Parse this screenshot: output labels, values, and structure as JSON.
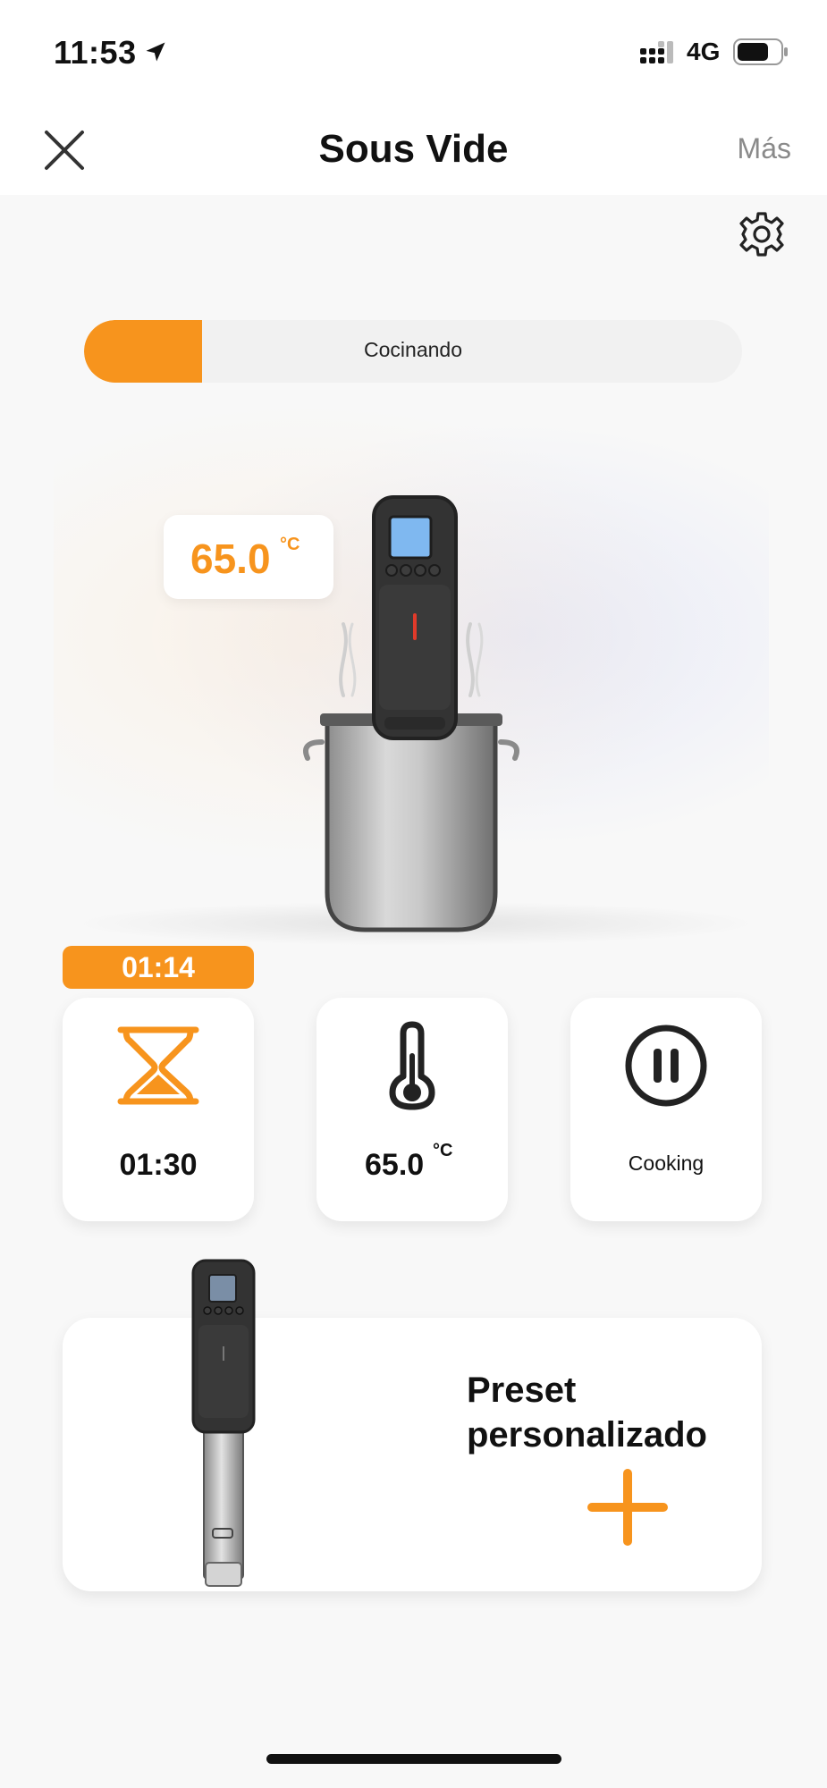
{
  "status_bar": {
    "time": "11:53",
    "network": "4G"
  },
  "header": {
    "title": "Sous Vide",
    "more_label": "Más"
  },
  "cooking": {
    "status_label": "Cocinando",
    "progress": 0.18,
    "current_temp": "65.0",
    "current_temp_unit": "°C",
    "elapsed_time": "01:14"
  },
  "cards": {
    "timer": {
      "icon": "hourglass-icon",
      "value": "01:30"
    },
    "temperature": {
      "icon": "thermometer-icon",
      "value": "65.0",
      "unit": "°C"
    },
    "status": {
      "icon": "pause-icon",
      "label": "Cooking"
    }
  },
  "preset": {
    "title": "Preset personalizado",
    "add_icon": "plus-icon"
  },
  "colors": {
    "accent": "#f7941d",
    "text": "#111111",
    "muted": "#8a8a8a",
    "background": "#f8f8f8"
  }
}
